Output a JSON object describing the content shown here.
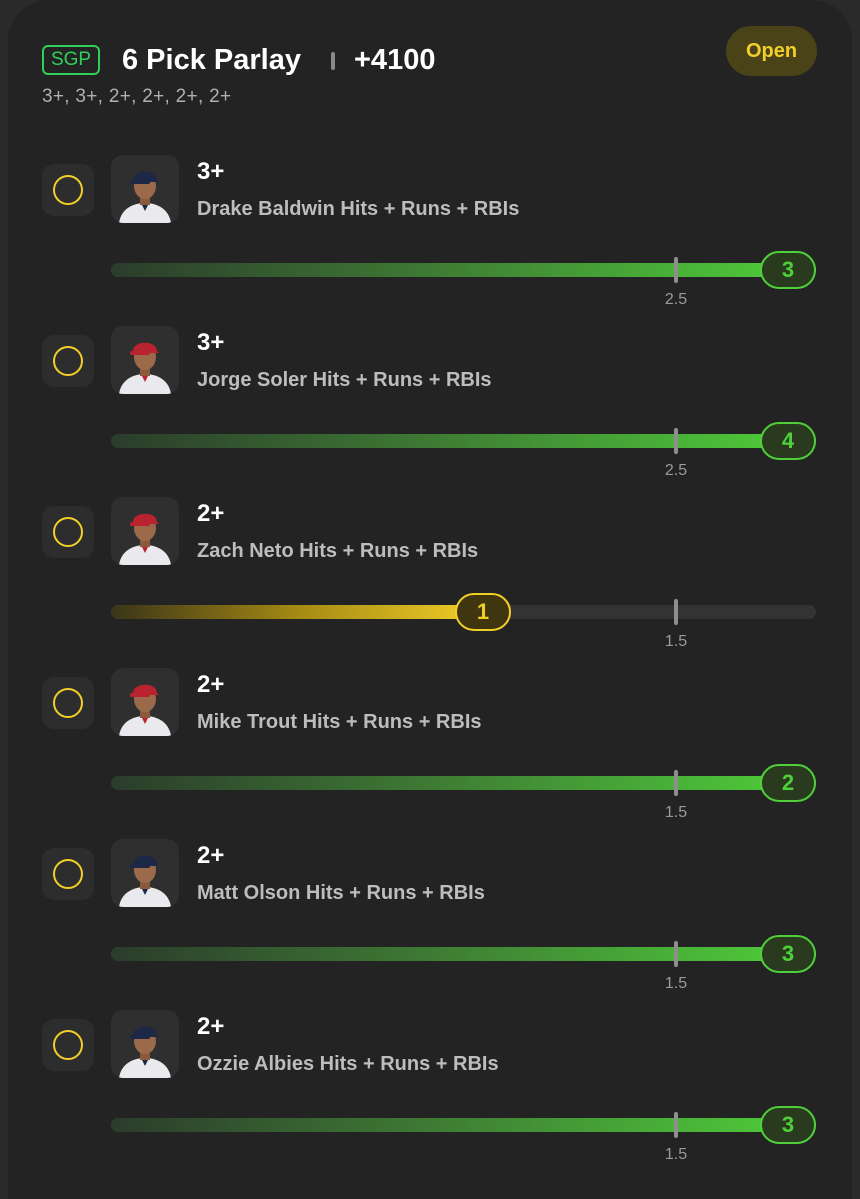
{
  "header": {
    "badge": "SGP",
    "title": "6 Pick Parlay",
    "odds": "+4100",
    "subtitle": "3+, 3+, 2+, 2+, 2+, 2+",
    "status": "Open"
  },
  "colors": {
    "hit": "#4fd03a",
    "miss": "#f2cf28",
    "background": "#232323"
  },
  "legs": [
    {
      "threshold": "3+",
      "market": "Drake Baldwin Hits + Runs + RBIs",
      "line": "2.5",
      "actual": "3",
      "line_value": 2.5,
      "actual_value": 3,
      "progress": 1.0,
      "status": "hit",
      "cap": "navy"
    },
    {
      "threshold": "3+",
      "market": "Jorge Soler Hits + Runs + RBIs",
      "line": "2.5",
      "actual": "4",
      "line_value": 2.5,
      "actual_value": 4,
      "progress": 1.0,
      "status": "hit",
      "cap": "red"
    },
    {
      "threshold": "2+",
      "market": "Zach Neto Hits + Runs + RBIs",
      "line": "1.5",
      "actual": "1",
      "line_value": 1.5,
      "actual_value": 1,
      "progress": 0.53,
      "status": "miss",
      "cap": "red"
    },
    {
      "threshold": "2+",
      "market": "Mike Trout Hits + Runs + RBIs",
      "line": "1.5",
      "actual": "2",
      "line_value": 1.5,
      "actual_value": 2,
      "progress": 1.0,
      "status": "hit",
      "cap": "red"
    },
    {
      "threshold": "2+",
      "market": "Matt Olson Hits + Runs + RBIs",
      "line": "1.5",
      "actual": "3",
      "line_value": 1.5,
      "actual_value": 3,
      "progress": 1.0,
      "status": "hit",
      "cap": "navy"
    },
    {
      "threshold": "2+",
      "market": "Ozzie Albies Hits + Runs + RBIs",
      "line": "1.5",
      "actual": "3",
      "line_value": 1.5,
      "actual_value": 3,
      "progress": 1.0,
      "status": "hit",
      "cap": "navy"
    }
  ]
}
